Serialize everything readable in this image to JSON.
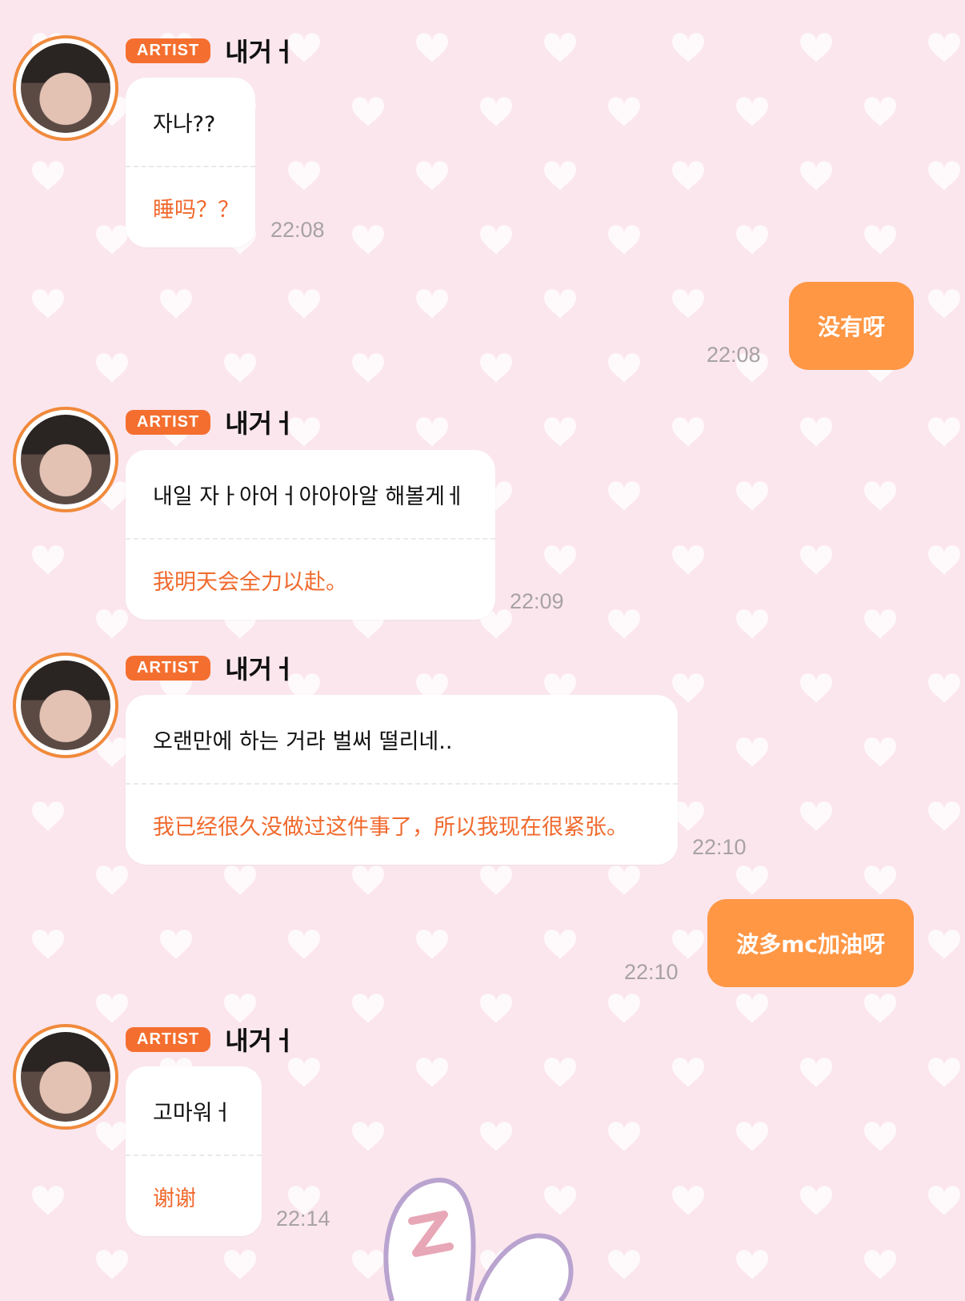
{
  "artist_badge": "ARTIST",
  "sender_name": "내거ㅓ",
  "messages": [
    {
      "original": "자나??",
      "translation": "睡吗？？",
      "time": "22:08"
    },
    {
      "reply": "没有呀",
      "time": "22:08"
    },
    {
      "original": "내일 자ㅏ아어ㅓ아아아알 해볼게ㅔ",
      "translation": "我明天会全力以赴。",
      "time": "22:09"
    },
    {
      "original": "오랜만에 하는 거라 벌써 떨리네..",
      "translation": "我已经很久没做过这件事了，所以我现在很紧张。",
      "time": "22:10"
    },
    {
      "reply": "波多mc加油呀",
      "time": "22:10"
    },
    {
      "original": "고마워ㅓ",
      "translation": "谢谢",
      "time": "22:14"
    }
  ],
  "colors": {
    "accent": "#f46f2f",
    "reply_bubble": "#ff9745",
    "translation_text": "#f06a2e",
    "background": "#fbe6ee"
  }
}
